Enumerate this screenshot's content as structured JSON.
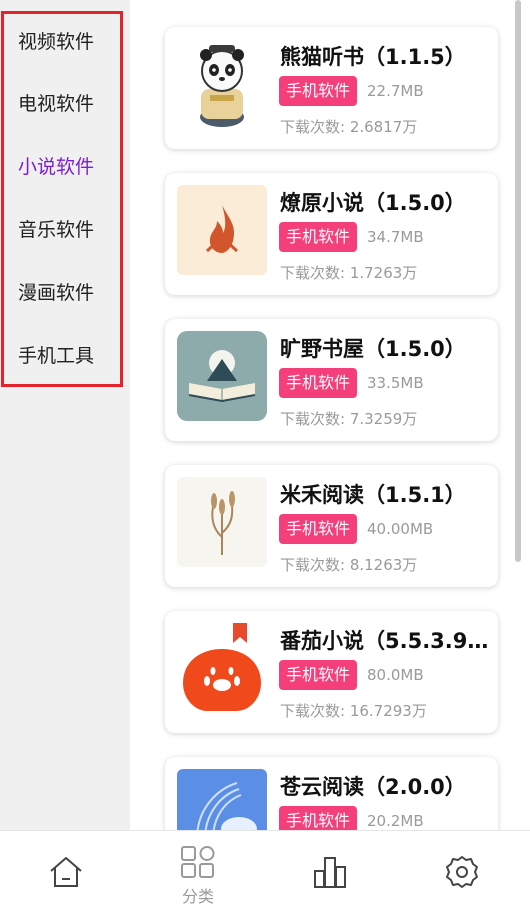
{
  "categories": [
    {
      "label": "视频软件",
      "active": false
    },
    {
      "label": "电视软件",
      "active": false
    },
    {
      "label": "小说软件",
      "active": true
    },
    {
      "label": "音乐软件",
      "active": false
    },
    {
      "label": "漫画软件",
      "active": false
    },
    {
      "label": "手机工具",
      "active": false
    }
  ],
  "apps": [
    {
      "title": "熊猫听书（1.1.5）",
      "badge": "手机软件",
      "size": "22.7MB",
      "downloads": "下载次数: 2.6817万",
      "icon": "panda-icon"
    },
    {
      "title": "燎原小说（1.5.0）",
      "badge": "手机软件",
      "size": "34.7MB",
      "downloads": "下载次数: 1.7263万",
      "icon": "flame-icon"
    },
    {
      "title": "旷野书屋（1.5.0）",
      "badge": "手机软件",
      "size": "33.5MB",
      "downloads": "下载次数: 7.3259万",
      "icon": "book-mountain-icon"
    },
    {
      "title": "米禾阅读（1.5.1）",
      "badge": "手机软件",
      "size": "40.00MB",
      "downloads": "下载次数: 8.1263万",
      "icon": "wheat-icon"
    },
    {
      "title": "番茄小说（5.5.3.9…",
      "badge": "手机软件",
      "size": "80.0MB",
      "downloads": "下载次数: 16.7293万",
      "icon": "tomato-icon"
    },
    {
      "title": "苍云阅读（2.0.0）",
      "badge": "手机软件",
      "size": "20.2MB",
      "downloads": "",
      "icon": "cloud-book-icon"
    }
  ],
  "tabbar": {
    "home": "home-icon",
    "category_label": "分类",
    "stats": "bar-chart-icon",
    "settings": "gear-icon"
  },
  "colors": {
    "active_category": "#7a1fd1",
    "badge": "#f43f7a",
    "highlight_border": "#e5232c"
  }
}
